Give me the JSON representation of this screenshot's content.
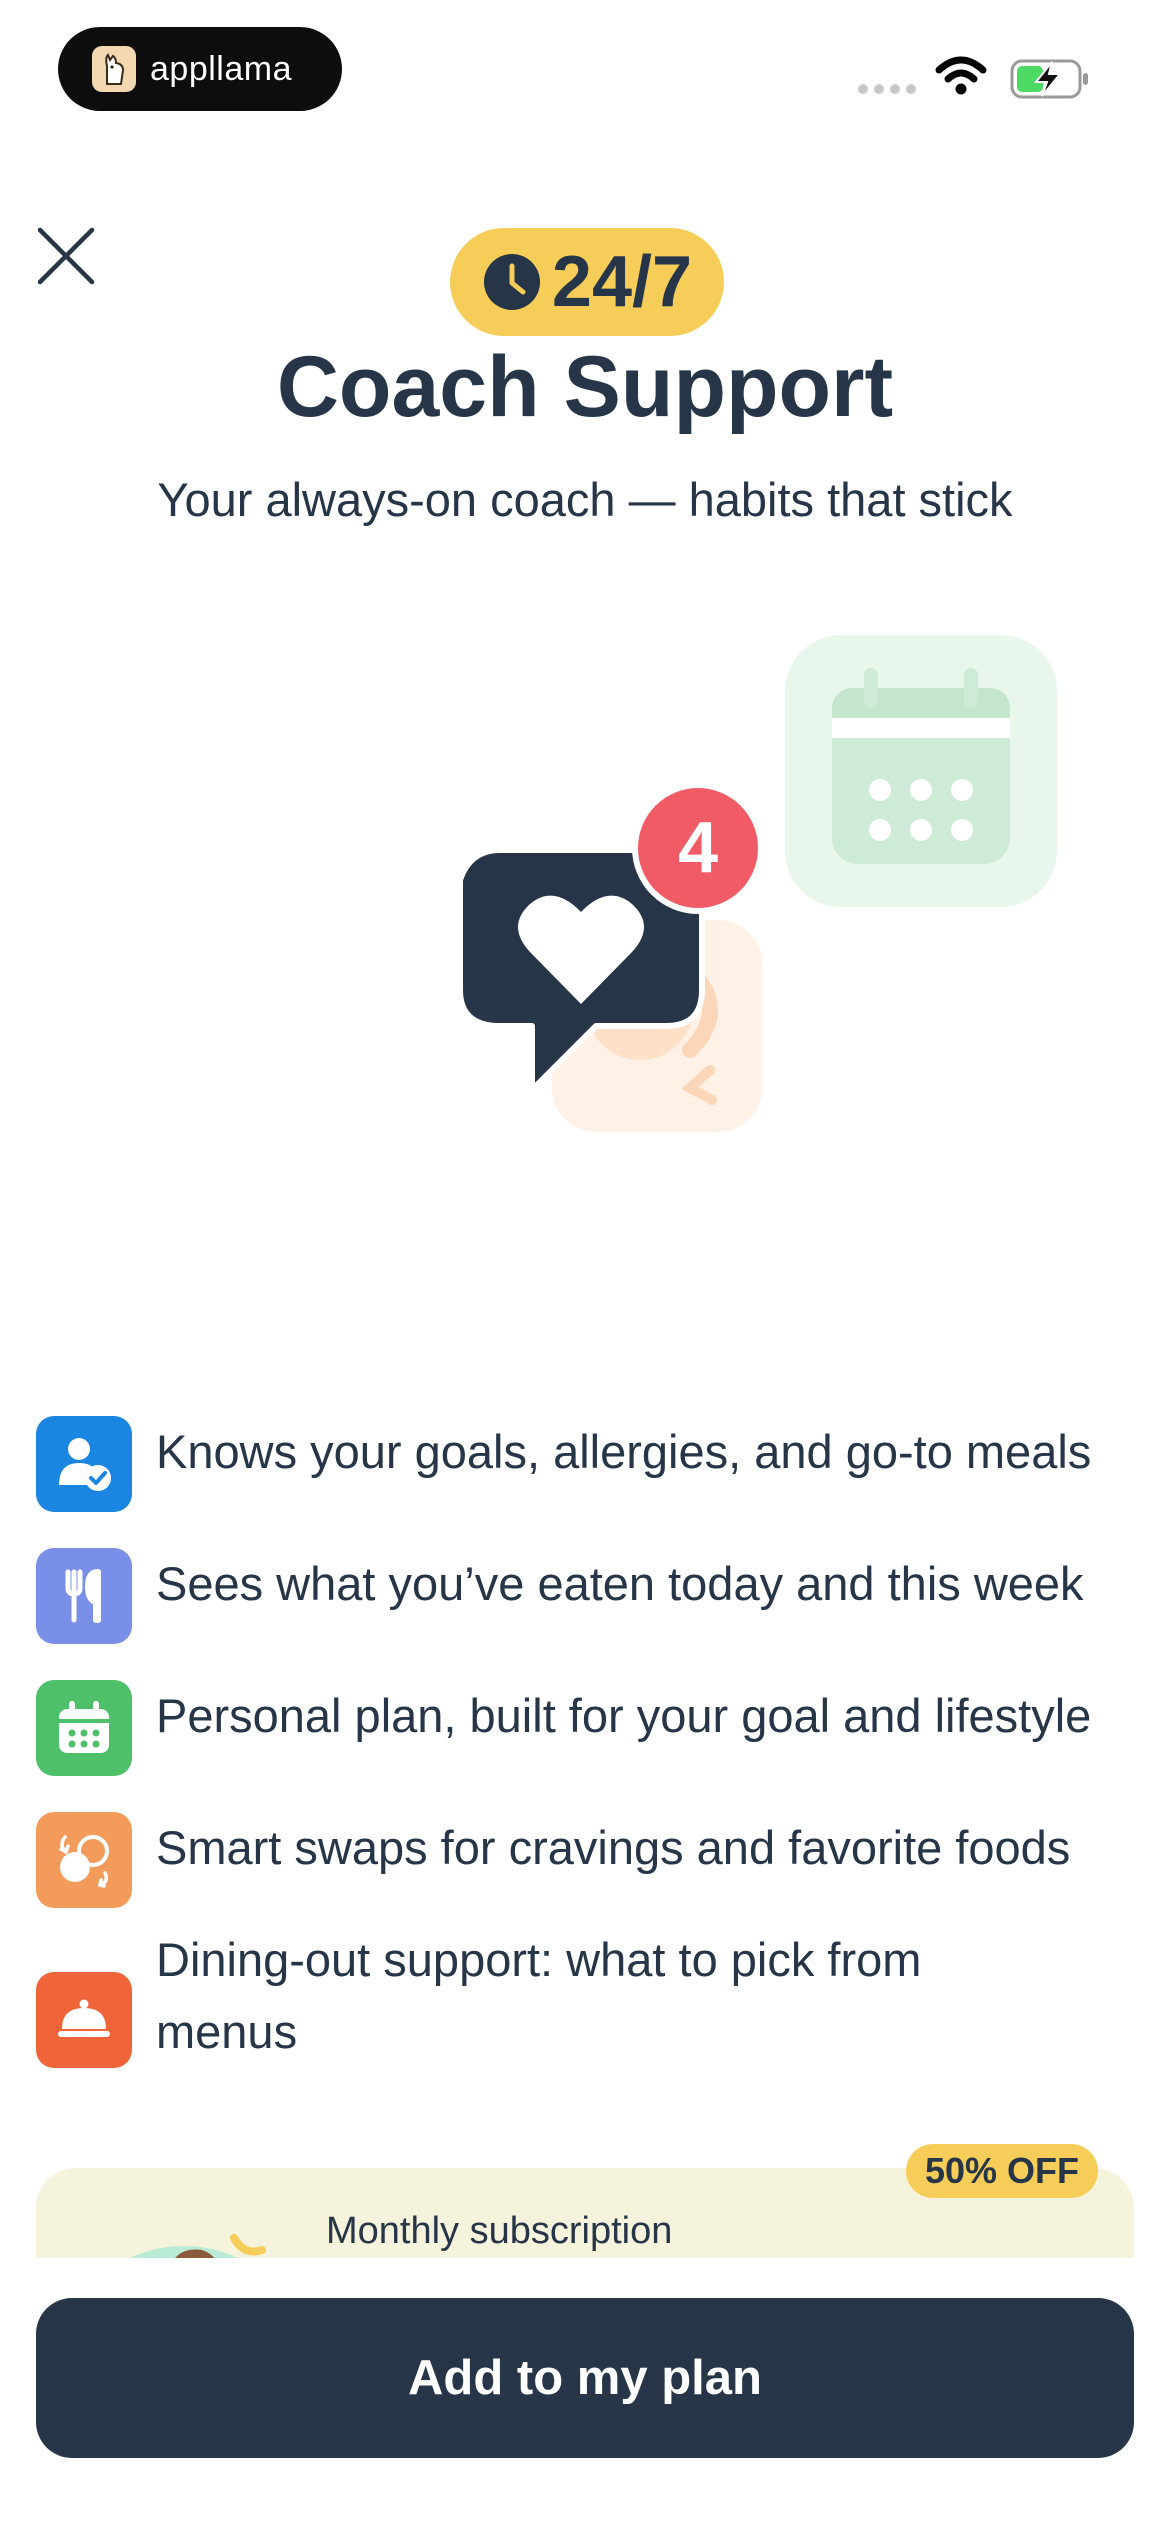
{
  "status_bar": {
    "brand": "appllama"
  },
  "header": {
    "badge": "24/7",
    "title": "Coach Support",
    "subtitle": "Your always-on coach — habits that stick"
  },
  "illustration": {
    "notification_count": "4"
  },
  "features": [
    {
      "label": "Knows your goals, allergies, and go-to meals",
      "icon": "person-check-icon",
      "color": "#1a86e2"
    },
    {
      "label": "Sees what you’ve eaten today and this week",
      "icon": "fork-knife-icon",
      "color": "#7a8fe8"
    },
    {
      "label": "Personal plan, built for your goal and lifestyle",
      "icon": "calendar-icon",
      "color": "#4ec06a"
    },
    {
      "label": "Smart swaps for cravings and favorite foods",
      "icon": "swap-icon",
      "color": "#f39b5a"
    },
    {
      "label": "Dining-out support: what to pick from menus",
      "icon": "cloche-icon",
      "color": "#f0643a"
    }
  ],
  "offer": {
    "discount": "50% OFF",
    "label": "Monthly subscription"
  },
  "cta": {
    "label": "Add to my plan"
  },
  "colors": {
    "navy": "#263548",
    "yellow": "#f5cd58",
    "notification": "#f05b66"
  }
}
